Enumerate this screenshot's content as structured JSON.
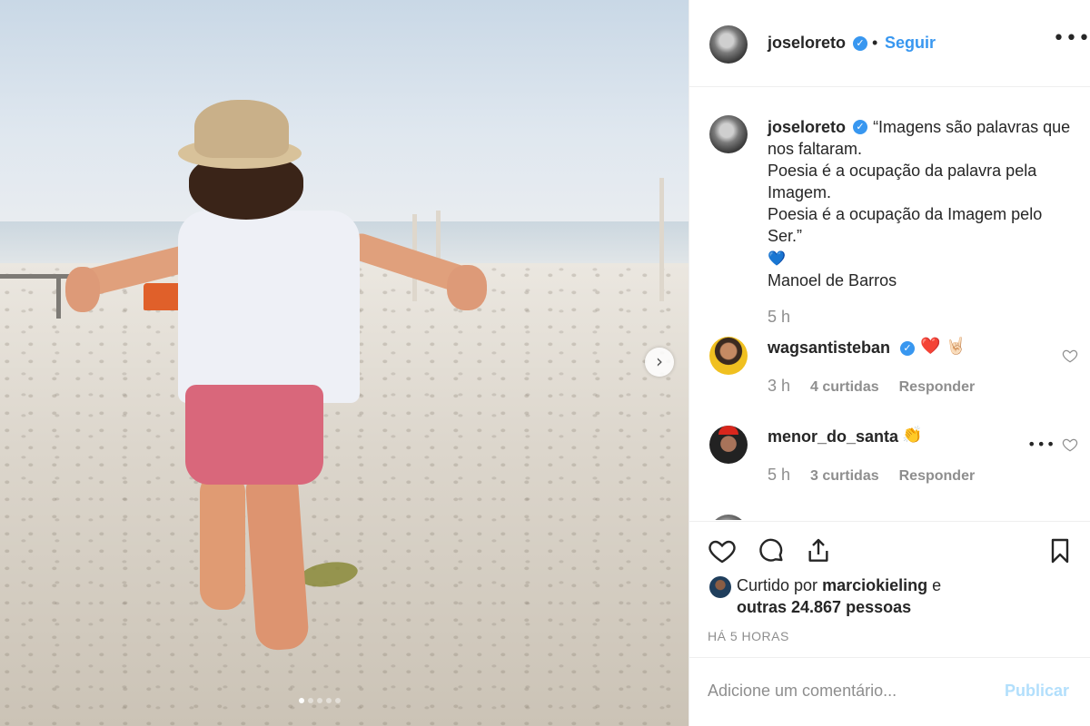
{
  "header": {
    "username": "joseloreto",
    "separator": "•",
    "follow_label": "Seguir"
  },
  "caption": {
    "username": "joseloreto",
    "text": "“Imagens são palavras que nos faltaram.",
    "lines": [
      "Poesia é a ocupação da palavra pela Imagem.",
      "Poesia é a ocupação da Imagem pelo Ser.”"
    ],
    "emoji": "💙",
    "author": "Manoel de Barros",
    "time": "5 h"
  },
  "comments": [
    {
      "username": "wagsantisteban",
      "verified": true,
      "text": "❤️ 🤘🏻",
      "time": "3 h",
      "likes": "4 curtidas",
      "reply_label": "Responder"
    },
    {
      "username": "menor_do_santa",
      "verified": false,
      "text": "👏",
      "time": "5 h",
      "likes": "3 curtidas",
      "reply_label": "Responder"
    }
  ],
  "likes": {
    "prefix": "Curtido por",
    "user": "marciokieling",
    "conj": "e",
    "others": "outras 24.867 pessoas"
  },
  "timestamp": "HÁ 5 HORAS",
  "comment_box": {
    "placeholder": "Adicione um comentário...",
    "publish_label": "Publicar"
  },
  "carousel": {
    "total": 5,
    "active_index": 0
  },
  "colors": {
    "accent": "#3897f0",
    "publish_disabled": "#b2dffc",
    "secondary_text": "#8e8e8e"
  },
  "icons": [
    "verified-icon",
    "more-options-icon",
    "heart-icon",
    "comment-icon",
    "share-icon",
    "bookmark-icon",
    "chevron-right-icon"
  ]
}
